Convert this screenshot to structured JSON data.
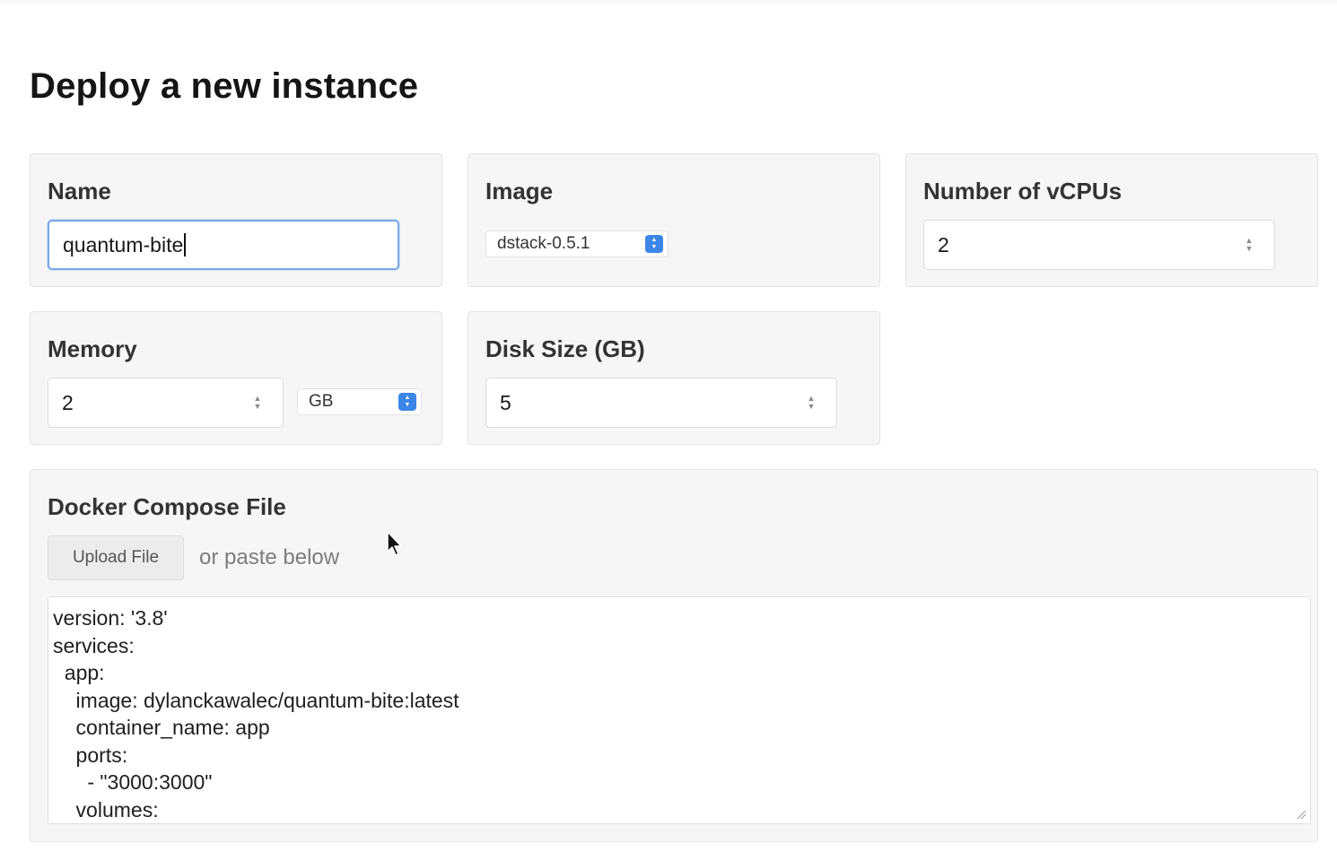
{
  "page": {
    "title": "Deploy a new instance"
  },
  "name_field": {
    "label": "Name",
    "value": "quantum-bite"
  },
  "image_field": {
    "label": "Image",
    "selected": "dstack-0.5.1"
  },
  "vcpu_field": {
    "label": "Number of vCPUs",
    "value": "2"
  },
  "memory_field": {
    "label": "Memory",
    "value": "2",
    "unit": "GB"
  },
  "disk_field": {
    "label": "Disk Size (GB)",
    "value": "5"
  },
  "compose": {
    "label": "Docker Compose File",
    "upload_label": "Upload File",
    "hint": "or paste below",
    "lines": [
      "version: '3.8'",
      "services:",
      "  app:",
      "    image: dylanckawalec/quantum-bite:latest",
      "    container_name: app",
      "    ports:",
      "      - \"3000:3000\"",
      "    volumes:"
    ]
  },
  "colors": {
    "accent": "#3b86e8",
    "focus_ring": "#7aa7e6",
    "card_bg": "#f6f6f6"
  },
  "icons": [
    "spinner-icon",
    "select-arrows-icon",
    "resize-grip-icon",
    "mouse-cursor-icon"
  ]
}
